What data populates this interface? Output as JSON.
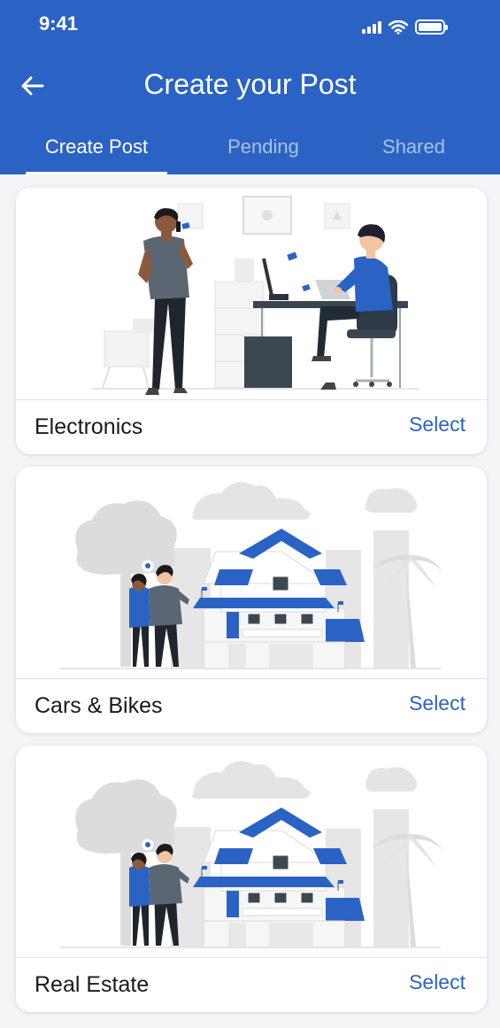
{
  "status_bar": {
    "time": "9:41"
  },
  "header": {
    "title": "Create your Post"
  },
  "tabs": [
    {
      "label": "Create Post",
      "active": true
    },
    {
      "label": "Pending",
      "active": false
    },
    {
      "label": "Shared",
      "active": false
    }
  ],
  "categories": [
    {
      "name": "Electronics",
      "action": "Select",
      "illustration": "office-workers-illustration"
    },
    {
      "name": "Cars & Bikes",
      "action": "Select",
      "illustration": "house-couple-illustration"
    },
    {
      "name": "Real Estate",
      "action": "Select",
      "illustration": "house-couple-illustration"
    }
  ],
  "colors": {
    "primary": "#2b63c4",
    "background": "#f3f4f6",
    "card": "#ffffff",
    "illustration_gray": "#dcdcdc",
    "text": "#1a1a1a"
  }
}
